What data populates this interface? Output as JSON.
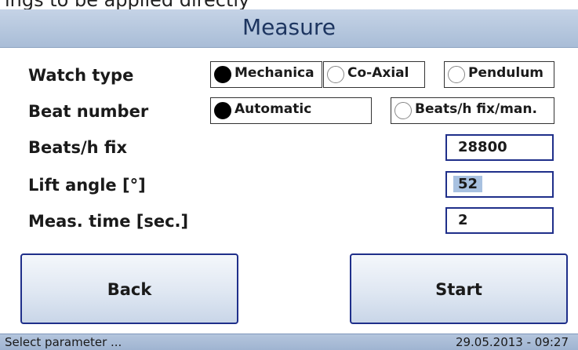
{
  "top_cut_text": "ings to be applied directly",
  "header": {
    "title": "Measure"
  },
  "rows": {
    "watch_type": {
      "label": "Watch type",
      "options": [
        "Mechanica",
        "Co-Axial",
        "Pendulum"
      ],
      "selected": "Mechanica"
    },
    "beat_number": {
      "label": "Beat number",
      "options": [
        "Automatic",
        "Beats/h fix/man."
      ],
      "selected": "Automatic"
    },
    "beats_fix": {
      "label": "Beats/h fix",
      "value": "28800"
    },
    "lift_angle": {
      "label": "Lift angle [°]",
      "value": "52"
    },
    "meas_time": {
      "label": "Meas. time [sec.]",
      "value": "2"
    }
  },
  "buttons": {
    "back": "Back",
    "start": "Start"
  },
  "status": {
    "left": "Select parameter ...",
    "right": "29.05.2013 - 09:27"
  }
}
